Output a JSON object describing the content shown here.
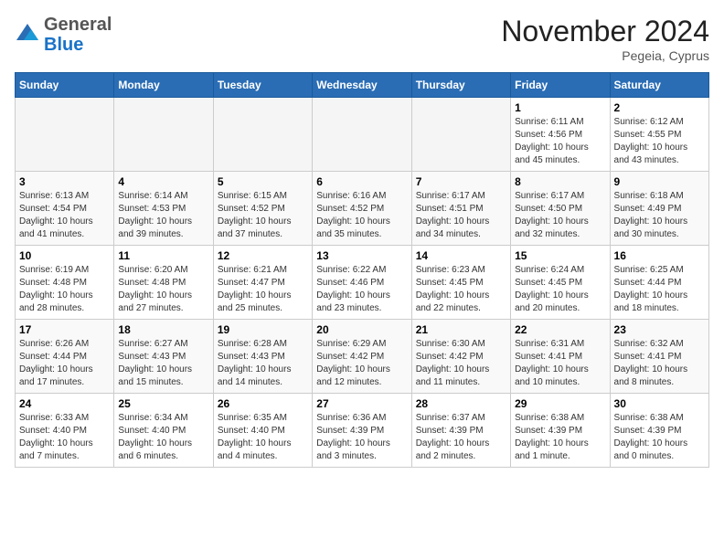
{
  "header": {
    "logo_general": "General",
    "logo_blue": "Blue",
    "month_title": "November 2024",
    "location": "Pegeia, Cyprus"
  },
  "weekdays": [
    "Sunday",
    "Monday",
    "Tuesday",
    "Wednesday",
    "Thursday",
    "Friday",
    "Saturday"
  ],
  "weeks": [
    [
      {
        "day": "",
        "empty": true
      },
      {
        "day": "",
        "empty": true
      },
      {
        "day": "",
        "empty": true
      },
      {
        "day": "",
        "empty": true
      },
      {
        "day": "",
        "empty": true
      },
      {
        "day": "1",
        "sunrise": "Sunrise: 6:11 AM",
        "sunset": "Sunset: 4:56 PM",
        "daylight": "Daylight: 10 hours and 45 minutes."
      },
      {
        "day": "2",
        "sunrise": "Sunrise: 6:12 AM",
        "sunset": "Sunset: 4:55 PM",
        "daylight": "Daylight: 10 hours and 43 minutes."
      }
    ],
    [
      {
        "day": "3",
        "sunrise": "Sunrise: 6:13 AM",
        "sunset": "Sunset: 4:54 PM",
        "daylight": "Daylight: 10 hours and 41 minutes."
      },
      {
        "day": "4",
        "sunrise": "Sunrise: 6:14 AM",
        "sunset": "Sunset: 4:53 PM",
        "daylight": "Daylight: 10 hours and 39 minutes."
      },
      {
        "day": "5",
        "sunrise": "Sunrise: 6:15 AM",
        "sunset": "Sunset: 4:52 PM",
        "daylight": "Daylight: 10 hours and 37 minutes."
      },
      {
        "day": "6",
        "sunrise": "Sunrise: 6:16 AM",
        "sunset": "Sunset: 4:52 PM",
        "daylight": "Daylight: 10 hours and 35 minutes."
      },
      {
        "day": "7",
        "sunrise": "Sunrise: 6:17 AM",
        "sunset": "Sunset: 4:51 PM",
        "daylight": "Daylight: 10 hours and 34 minutes."
      },
      {
        "day": "8",
        "sunrise": "Sunrise: 6:17 AM",
        "sunset": "Sunset: 4:50 PM",
        "daylight": "Daylight: 10 hours and 32 minutes."
      },
      {
        "day": "9",
        "sunrise": "Sunrise: 6:18 AM",
        "sunset": "Sunset: 4:49 PM",
        "daylight": "Daylight: 10 hours and 30 minutes."
      }
    ],
    [
      {
        "day": "10",
        "sunrise": "Sunrise: 6:19 AM",
        "sunset": "Sunset: 4:48 PM",
        "daylight": "Daylight: 10 hours and 28 minutes."
      },
      {
        "day": "11",
        "sunrise": "Sunrise: 6:20 AM",
        "sunset": "Sunset: 4:48 PM",
        "daylight": "Daylight: 10 hours and 27 minutes."
      },
      {
        "day": "12",
        "sunrise": "Sunrise: 6:21 AM",
        "sunset": "Sunset: 4:47 PM",
        "daylight": "Daylight: 10 hours and 25 minutes."
      },
      {
        "day": "13",
        "sunrise": "Sunrise: 6:22 AM",
        "sunset": "Sunset: 4:46 PM",
        "daylight": "Daylight: 10 hours and 23 minutes."
      },
      {
        "day": "14",
        "sunrise": "Sunrise: 6:23 AM",
        "sunset": "Sunset: 4:45 PM",
        "daylight": "Daylight: 10 hours and 22 minutes."
      },
      {
        "day": "15",
        "sunrise": "Sunrise: 6:24 AM",
        "sunset": "Sunset: 4:45 PM",
        "daylight": "Daylight: 10 hours and 20 minutes."
      },
      {
        "day": "16",
        "sunrise": "Sunrise: 6:25 AM",
        "sunset": "Sunset: 4:44 PM",
        "daylight": "Daylight: 10 hours and 18 minutes."
      }
    ],
    [
      {
        "day": "17",
        "sunrise": "Sunrise: 6:26 AM",
        "sunset": "Sunset: 4:44 PM",
        "daylight": "Daylight: 10 hours and 17 minutes."
      },
      {
        "day": "18",
        "sunrise": "Sunrise: 6:27 AM",
        "sunset": "Sunset: 4:43 PM",
        "daylight": "Daylight: 10 hours and 15 minutes."
      },
      {
        "day": "19",
        "sunrise": "Sunrise: 6:28 AM",
        "sunset": "Sunset: 4:43 PM",
        "daylight": "Daylight: 10 hours and 14 minutes."
      },
      {
        "day": "20",
        "sunrise": "Sunrise: 6:29 AM",
        "sunset": "Sunset: 4:42 PM",
        "daylight": "Daylight: 10 hours and 12 minutes."
      },
      {
        "day": "21",
        "sunrise": "Sunrise: 6:30 AM",
        "sunset": "Sunset: 4:42 PM",
        "daylight": "Daylight: 10 hours and 11 minutes."
      },
      {
        "day": "22",
        "sunrise": "Sunrise: 6:31 AM",
        "sunset": "Sunset: 4:41 PM",
        "daylight": "Daylight: 10 hours and 10 minutes."
      },
      {
        "day": "23",
        "sunrise": "Sunrise: 6:32 AM",
        "sunset": "Sunset: 4:41 PM",
        "daylight": "Daylight: 10 hours and 8 minutes."
      }
    ],
    [
      {
        "day": "24",
        "sunrise": "Sunrise: 6:33 AM",
        "sunset": "Sunset: 4:40 PM",
        "daylight": "Daylight: 10 hours and 7 minutes."
      },
      {
        "day": "25",
        "sunrise": "Sunrise: 6:34 AM",
        "sunset": "Sunset: 4:40 PM",
        "daylight": "Daylight: 10 hours and 6 minutes."
      },
      {
        "day": "26",
        "sunrise": "Sunrise: 6:35 AM",
        "sunset": "Sunset: 4:40 PM",
        "daylight": "Daylight: 10 hours and 4 minutes."
      },
      {
        "day": "27",
        "sunrise": "Sunrise: 6:36 AM",
        "sunset": "Sunset: 4:39 PM",
        "daylight": "Daylight: 10 hours and 3 minutes."
      },
      {
        "day": "28",
        "sunrise": "Sunrise: 6:37 AM",
        "sunset": "Sunset: 4:39 PM",
        "daylight": "Daylight: 10 hours and 2 minutes."
      },
      {
        "day": "29",
        "sunrise": "Sunrise: 6:38 AM",
        "sunset": "Sunset: 4:39 PM",
        "daylight": "Daylight: 10 hours and 1 minute."
      },
      {
        "day": "30",
        "sunrise": "Sunrise: 6:38 AM",
        "sunset": "Sunset: 4:39 PM",
        "daylight": "Daylight: 10 hours and 0 minutes."
      }
    ]
  ]
}
